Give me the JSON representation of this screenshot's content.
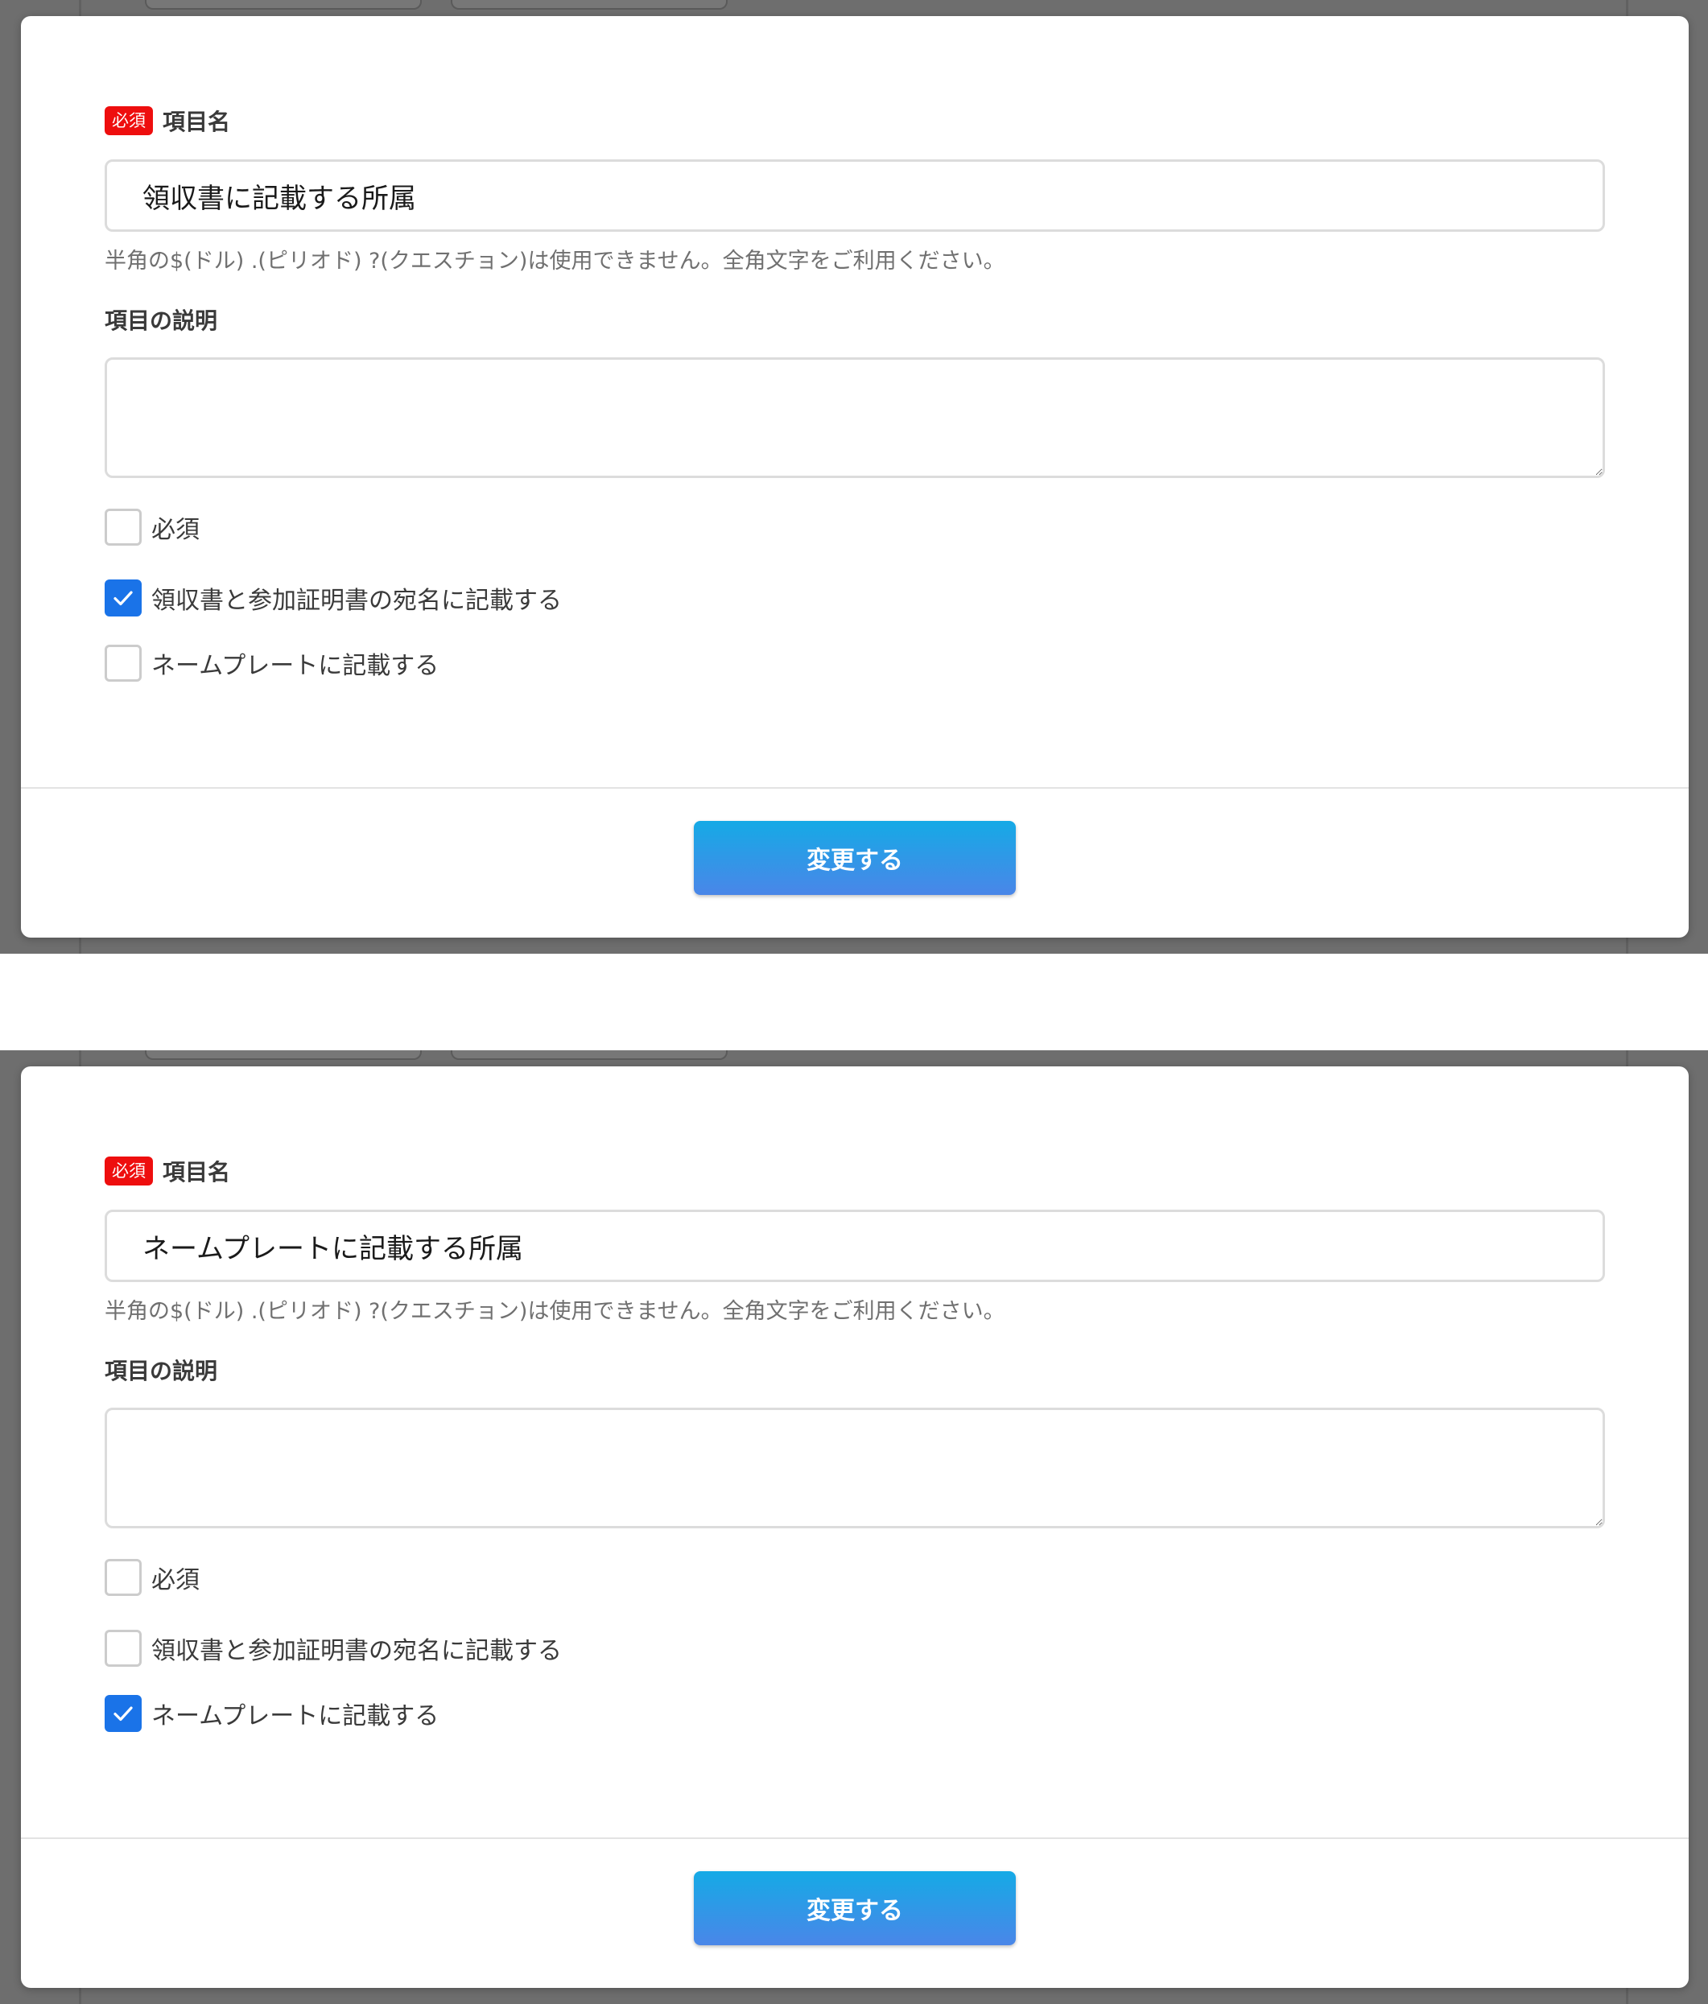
{
  "panels": [
    {
      "required_badge": "必須",
      "name_label": "項目名",
      "name_value": "領収書に記載する所属",
      "hint": "半角の$(ドル) .(ピリオド) ?(クエスチョン)は使用できません。全角文字をご利用ください。",
      "desc_label": "項目の説明",
      "desc_value": "",
      "checkboxes": [
        {
          "label": "必須",
          "checked": false
        },
        {
          "label": "領収書と参加証明書の宛名に記載する",
          "checked": true
        },
        {
          "label": "ネームプレートに記載する",
          "checked": false
        }
      ],
      "submit_label": "変更する"
    },
    {
      "required_badge": "必須",
      "name_label": "項目名",
      "name_value": "ネームプレートに記載する所属",
      "hint": "半角の$(ドル) .(ピリオド) ?(クエスチョン)は使用できません。全角文字をご利用ください。",
      "desc_label": "項目の説明",
      "desc_value": "",
      "checkboxes": [
        {
          "label": "必須",
          "checked": false
        },
        {
          "label": "領収書と参加証明書の宛名に記載する",
          "checked": false
        },
        {
          "label": "ネームプレートに記載する",
          "checked": true
        }
      ],
      "submit_label": "変更する"
    }
  ],
  "colors": {
    "overlay": "#6e6e6e",
    "required_badge": "#ee0e0e",
    "checkbox_checked": "#1a73e8",
    "button_gradient_top": "#15aae6",
    "button_gradient_bottom": "#4a86e8"
  },
  "icons": {
    "checkbox_checked": "checkmark-icon"
  }
}
